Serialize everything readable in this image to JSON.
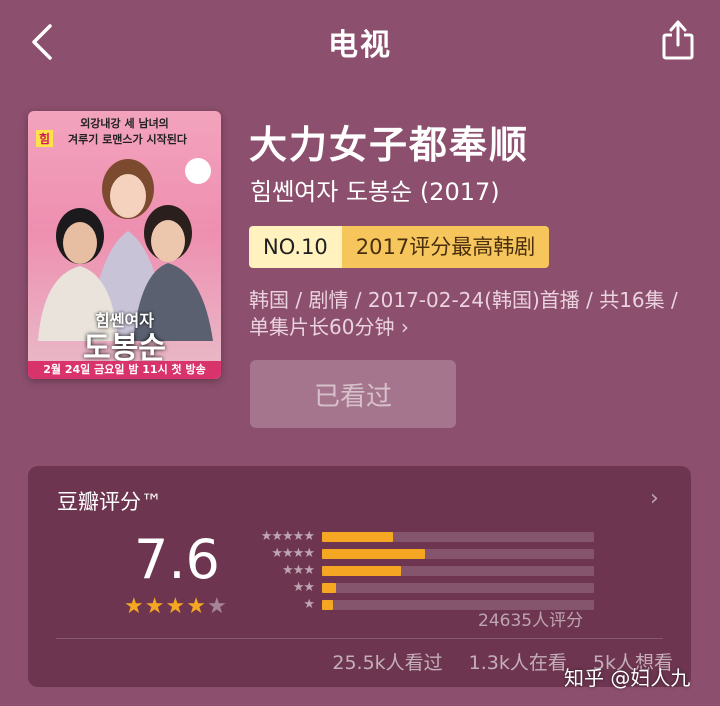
{
  "header": {
    "title": "电视",
    "back_icon": "chevron-left-icon",
    "share_icon": "share-icon"
  },
  "poster": {
    "tagline": "외강내강 세 남녀의",
    "highlight": "힘",
    "tagline2": "겨루기 로맨스가 시작된다",
    "korean_title_line1": "힘쎈여자",
    "korean_title_line2": "도봉순",
    "airing": "2월 24일 금요일 밤 11시 첫 방송"
  },
  "show": {
    "title": "大力女子都奉顺",
    "original_title": "힘쎈여자 도봉순 (2017)",
    "rank_no": "NO.10",
    "rank_text": "2017评分最高韩剧",
    "meta": "韩国 / 剧情 / 2017-02-24(韩国)首播 / 共16集 / 单集片长60分钟",
    "meta_chevron": "›",
    "watched_label": "已看过"
  },
  "rating": {
    "title": "豆瓣评分™",
    "arrow": "›",
    "score": "7.6",
    "stars_filled": 4,
    "stars_total": 5,
    "distribution": [
      {
        "stars": 5,
        "label": "★★★★★",
        "fraction": 0.26
      },
      {
        "stars": 4,
        "label": "★★★★",
        "fraction": 0.38
      },
      {
        "stars": 3,
        "label": "★★★",
        "fraction": 0.29
      },
      {
        "stars": 2,
        "label": "★★",
        "fraction": 0.05
      },
      {
        "stars": 1,
        "label": "★",
        "fraction": 0.04
      }
    ],
    "votes": "24635人评分",
    "watched": "25.5k人看过",
    "watching": "1.3k人在看",
    "want": "5k人想看"
  },
  "watermark": "知乎 @妇人九",
  "colors": {
    "background": "#8c4f6d",
    "accent_star": "#f5a623",
    "rank_badge_light": "#fff2be",
    "rank_badge_gold": "#f6c65c"
  }
}
